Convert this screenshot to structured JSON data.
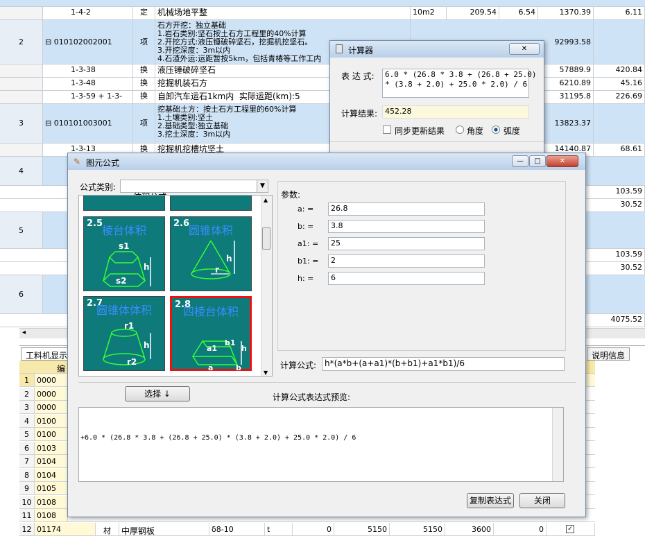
{
  "sheet": {
    "rows": [
      {
        "code": "1-4-2",
        "type": "定",
        "desc": "机械场地平整",
        "unit": "10m2",
        "qty": "209.54",
        "price": "6.54",
        "total": "1370.39",
        "last": "6.11"
      },
      {
        "no": "2",
        "code": "010102002001",
        "type": "项",
        "desc": "石方开挖：独立基础\n1.岩石类别:坚石按土石方工程里的40%计算\n2.开挖方式:液压锤破碎坚石，挖掘机挖坚石。\n3.开挖深度：3m以内\n4.石渣外运:运距暂按5km，包括青椿等工作工内",
        "total": "92993.58"
      },
      {
        "code": "1-3-38",
        "type": "换",
        "desc": "液压锤破碎坚石",
        "total": "57889.9",
        "last": "420.84"
      },
      {
        "code": "1-3-48",
        "type": "换",
        "desc": "挖掘机装石方",
        "total": "6210.89",
        "last": "45.16"
      },
      {
        "code": "1-3-59 + 1-3-",
        "type": "换",
        "desc": "自卸汽车运石1km内  实际运距(km):5",
        "total": "31195.8",
        "last": "226.69"
      },
      {
        "no": "3",
        "code": "010101003001",
        "type": "项",
        "desc": "挖基础土方：按土石方工程里的60%计算\n1.土壤类别:坚土\n2.基础类型:独立基础\n3.挖土深度：3m以内",
        "total": "13823.37"
      },
      {
        "code": "1-3-13",
        "type": "换",
        "desc": "挖掘机挖槽坑坚土",
        "total": "14140.87",
        "last": "68.61"
      }
    ],
    "side_nos": [
      "4",
      "5",
      "6"
    ],
    "side_values": [
      "103.59",
      "30.52",
      "103.59",
      "30.52",
      "4075.52"
    ],
    "tab_left": "工料机显示",
    "tab_right": "说明信息"
  },
  "lower": {
    "header": "编",
    "rows": [
      "1",
      "2",
      "3",
      "4",
      "5",
      "6",
      "7",
      "8",
      "9",
      "10",
      "11",
      "12"
    ],
    "codes": [
      "0000",
      "0000",
      "0000",
      "0100",
      "0100",
      "0103",
      "0104",
      "0104",
      "0105",
      "0108",
      "0108",
      "01174"
    ],
    "last_row": {
      "type": "材",
      "name": "中厚钢板",
      "spec": "δ8-10",
      "unit": "t",
      "v1": "0",
      "v2": "5150",
      "v3": "5150",
      "v4": "3600",
      "v5": "0"
    }
  },
  "calc": {
    "title": "计算器",
    "expr_label": "表 达 式:",
    "expr": "6.0 * (26.8 * 3.8 + (26.8 + 25.0)\n* (3.8 + 2.0) + 25.0 * 2.0) / 6",
    "result_label": "计算结果:",
    "result": "452.28",
    "sync_label": "同步更新结果",
    "angle_label": "角度",
    "radian_label": "弧度"
  },
  "formula": {
    "title": "图元公式",
    "category_label": "公式类别:",
    "category": "体积公式",
    "tiles": [
      {
        "no": "2.5",
        "name": "棱台体积"
      },
      {
        "no": "2.6",
        "name": "圆锥体积"
      },
      {
        "no": "2.7",
        "name": "圆锥体体积"
      },
      {
        "no": "2.8",
        "name": "四棱台体积"
      }
    ],
    "params_label": "参数:",
    "params": [
      {
        "label": "a:  =",
        "value": "26.8"
      },
      {
        "label": "b:  =",
        "value": "3.8"
      },
      {
        "label": "a1:  =",
        "value": "25"
      },
      {
        "label": "b1:  =",
        "value": "2"
      },
      {
        "label": "h:  =",
        "value": "6"
      }
    ],
    "formula_label": "计算公式:",
    "formula": "h*(a*b+(a+a1)*(b+b1)+a1*b1)/6",
    "select_button": "选择 ↓",
    "preview_label": "计算公式表达式预览:",
    "preview": "+6.0 * (26.8 * 3.8 + (26.8 + 25.0) * (3.8 + 2.0) + 25.0 * 2.0) / 6",
    "copy_button": "复制表达式",
    "close_button": "关闭"
  }
}
